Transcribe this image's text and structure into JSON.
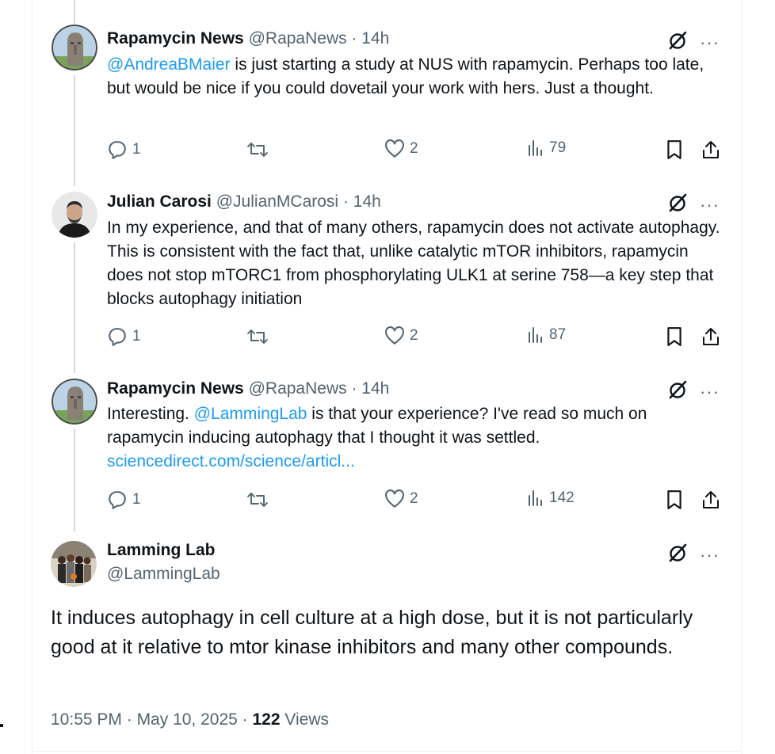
{
  "colors": {
    "link": "#1d9bf0",
    "muted": "#536471",
    "text": "#0f1419"
  },
  "replies": [
    {
      "display_name": "Rapamycin News",
      "handle": "@RapaNews",
      "sep": " · ",
      "time": "14h",
      "mention": "@AndreaBMaier",
      "text": " is just starting a study at NUS with rapamycin.  Perhaps too late, but would be nice if you could dovetail your work with hers.  Just a thought.",
      "reply_count": "1",
      "like_count": "2",
      "view_count": "79"
    },
    {
      "display_name": "Julian Carosi",
      "handle": "@JulianMCarosi",
      "sep": " · ",
      "time": "14h",
      "text": "In my experience, and that of many others, rapamycin does not activate autophagy. This is consistent with the fact that, unlike catalytic mTOR inhibitors, rapamycin does not stop mTORC1 from phosphorylating ULK1 at serine 758—a key step that blocks autophagy initiation",
      "reply_count": "1",
      "like_count": "2",
      "view_count": "87"
    },
    {
      "display_name": "Rapamycin News",
      "handle": "@RapaNews",
      "sep": " · ",
      "time": "14h",
      "text_before": "Interesting.  ",
      "mention": "@LammingLab",
      "text_after": " is that your experience?  I've read so much on rapamycin inducing autophagy that I thought it was settled.",
      "link": "sciencedirect.com/science/articl...",
      "reply_count": "1",
      "like_count": "2",
      "view_count": "142"
    }
  ],
  "main_tweet": {
    "display_name": "Lamming Lab",
    "handle": "@LammingLab",
    "text": "It induces autophagy in cell culture at a high dose, but it is not particularly good at it relative to mtor kinase inhibitors and many other compounds.",
    "time": "10:55 PM",
    "sep1": " · ",
    "date": "May 10, 2025",
    "sep2": " · ",
    "views_count": "122",
    "views_label": " Views"
  },
  "icons": {
    "more": "more-options-icon",
    "grok": "grok-icon",
    "reply": "reply-icon",
    "retweet": "retweet-icon",
    "like": "like-icon",
    "views": "views-icon",
    "bookmark": "bookmark-icon",
    "share": "share-icon"
  },
  "more_glyph": "···"
}
